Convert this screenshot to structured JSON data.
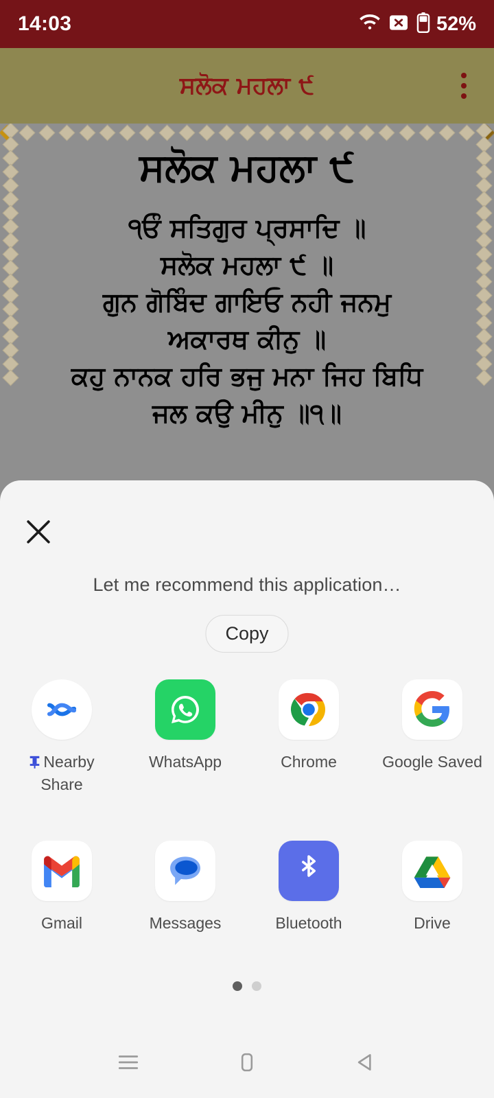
{
  "status_bar": {
    "time": "14:03",
    "battery_percent": "52%",
    "icons": {
      "wifi": "wifi-icon",
      "sim": "no-sim-icon",
      "battery": "battery-icon"
    }
  },
  "toolbar": {
    "title": "ਸਲੋਕ ਮਹਲਾ ੯",
    "overflow": "overflow-menu-icon",
    "background_color": "#8e8750",
    "title_color": "#8e1616"
  },
  "content": {
    "background_color": "#8f8f8f",
    "border_color": "#c8bda2",
    "heading": "ਸਲੋਕ ਮਹਲਾ ੯",
    "lines": [
      "੧ਓੰ ਸਤਿਗੁਰ ਪ੍ਰਸਾਦਿ ॥",
      "ਸਲੋਕ ਮਹਲਾ ੯ ॥",
      "ਗੁਨ ਗੋਬਿੰਦ ਗਾਇਓ ਨਹੀ ਜਨਮੁ",
      "ਅਕਾਰਥ ਕੀਨੁ ॥",
      "ਕਹੁ ਨਾਨਕ ਹਰਿ ਭਜੁ ਮਨਾ ਜਿਹ ਬਿਧਿ",
      "ਜਲ ਕਉ ਮੀਨੁ ॥੧॥"
    ]
  },
  "share_sheet": {
    "close_label": "close-icon",
    "subject": "Let me recommend this application…",
    "copy_label": "Copy",
    "apps": [
      {
        "name": "Nearby Share",
        "icon": "nearby-share-icon",
        "pinned": true
      },
      {
        "name": "WhatsApp",
        "icon": "whatsapp-icon",
        "pinned": false
      },
      {
        "name": "Chrome",
        "icon": "chrome-icon",
        "pinned": false
      },
      {
        "name": "Google Saved",
        "icon": "google-icon",
        "pinned": false
      },
      {
        "name": "Gmail",
        "icon": "gmail-icon",
        "pinned": false
      },
      {
        "name": "Messages",
        "icon": "messages-icon",
        "pinned": false
      },
      {
        "name": "Bluetooth",
        "icon": "bluetooth-icon",
        "pinned": false
      },
      {
        "name": "Drive",
        "icon": "drive-icon",
        "pinned": false
      }
    ],
    "pages": {
      "count": 2,
      "active": 1
    }
  },
  "nav_bar": {
    "recents": "recents-icon",
    "home": "home-icon",
    "back": "back-icon"
  }
}
